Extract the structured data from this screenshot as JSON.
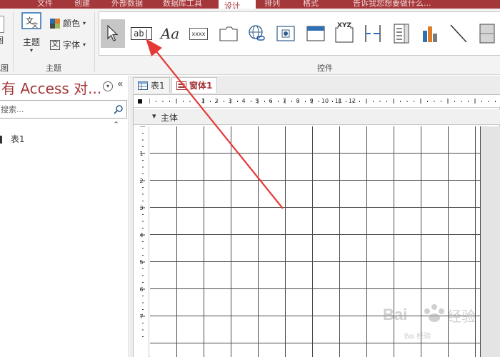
{
  "title_tabs": [
    {
      "label": "文件"
    },
    {
      "label": "创建"
    },
    {
      "label": "外部数据"
    },
    {
      "label": "数据库工具"
    },
    {
      "label": "设计"
    },
    {
      "label": "排列"
    },
    {
      "label": "格式"
    },
    {
      "label": "告诉我您想要做什么..."
    }
  ],
  "ribbon": {
    "view_group_label": "视图",
    "theme_group_label": "主题",
    "theme_button": "主题",
    "color_button": "颜色",
    "font_button": "字体",
    "controls_group_label": "控件",
    "controls": [
      {
        "name": "select-tool",
        "glyph": "arrow"
      },
      {
        "name": "textbox-tool",
        "glyph": "ab|"
      },
      {
        "name": "label-tool",
        "glyph": "Aa"
      },
      {
        "name": "button-tool",
        "glyph": "xxxx"
      },
      {
        "name": "tab-tool",
        "glyph": ""
      },
      {
        "name": "hyperlink-tool",
        "glyph": ""
      },
      {
        "name": "web-browser-tool",
        "glyph": ""
      },
      {
        "name": "navigation-tool",
        "glyph": ""
      },
      {
        "name": "option-group-tool",
        "glyph": "XYZ"
      },
      {
        "name": "page-break-tool",
        "glyph": ""
      },
      {
        "name": "combo-box-tool",
        "glyph": ""
      },
      {
        "name": "chart-tool",
        "glyph": ""
      },
      {
        "name": "line-tool",
        "glyph": ""
      },
      {
        "name": "toggle-tool",
        "glyph": ""
      }
    ]
  },
  "nav": {
    "title": "有 Access 对...",
    "search_placeholder": "搜索...",
    "items": [
      {
        "label": "表1"
      }
    ]
  },
  "doc": {
    "tabs": [
      {
        "label": "表1",
        "active": false
      },
      {
        "label": "窗体1",
        "active": true
      }
    ],
    "section_label": "主体",
    "ruler_h": [
      "1",
      "2",
      "3",
      "4",
      "5",
      "6",
      "7",
      "8",
      "9",
      "10",
      "11",
      "12"
    ],
    "ruler_v": [
      "1",
      "2",
      "3",
      "4",
      "5",
      "6",
      "7"
    ]
  },
  "watermark": "Bai 经验",
  "colors": {
    "accent": "#a4373a",
    "arrow": "#e53935"
  }
}
